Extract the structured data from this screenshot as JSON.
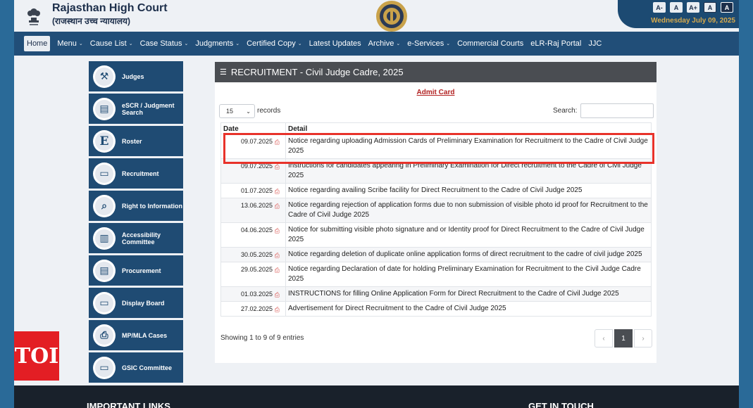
{
  "header": {
    "title": "Rajasthan High Court",
    "subtitle": "(राजस्थान उच्च न्यायालय)",
    "font_buttons": [
      "A-",
      "A",
      "A+",
      "A",
      "A"
    ],
    "date": "Wednesday July 09, 2025"
  },
  "nav": {
    "items": [
      {
        "label": "Home",
        "dropdown": false,
        "active": true
      },
      {
        "label": "Menu",
        "dropdown": true
      },
      {
        "label": "Cause List",
        "dropdown": true
      },
      {
        "label": "Case Status",
        "dropdown": true
      },
      {
        "label": "Judgments",
        "dropdown": true
      },
      {
        "label": "Certified Copy",
        "dropdown": true
      },
      {
        "label": "Latest Updates",
        "dropdown": false
      },
      {
        "label": "Archive",
        "dropdown": true
      },
      {
        "label": "e-Services",
        "dropdown": true
      },
      {
        "label": "Commercial Courts",
        "dropdown": false
      },
      {
        "label": "eLR-Raj Portal",
        "dropdown": false
      },
      {
        "label": "JJC",
        "dropdown": false
      }
    ]
  },
  "sidebar": {
    "items": [
      {
        "label": "Judges",
        "icon": "gavel-icon"
      },
      {
        "label": "eSCR / Judgment Search",
        "icon": "book-icon"
      },
      {
        "label": "Roster",
        "icon": "letter-e-icon"
      },
      {
        "label": "Recruitment",
        "icon": "id-card-icon"
      },
      {
        "label": "Right to Information",
        "icon": "magnifier-icon"
      },
      {
        "label": "Accessibility Committee",
        "icon": "document-icon"
      },
      {
        "label": "Procurement",
        "icon": "book-icon"
      },
      {
        "label": "Display Board",
        "icon": "monitor-icon"
      },
      {
        "label": "MP/MLA Cases",
        "icon": "pdf-file-icon"
      },
      {
        "label": "GSIC Committee",
        "icon": "monitor-icon"
      }
    ]
  },
  "panel": {
    "title": "RECRUITMENT - Civil Judge Cadre, 2025",
    "admit_card": "Admit Card",
    "length_value": "15",
    "length_label": "records",
    "search_label": "Search:",
    "search_value": "",
    "columns": [
      "Date",
      "Detail"
    ],
    "rows": [
      {
        "date": "09.07.2025",
        "detail": "Notice regarding uploading Admission Cards of Preliminary Examination for Recruitment to the Cadre of Civil Judge 2025"
      },
      {
        "date": "09.07.2025",
        "detail": "Instructions for candidates appearing in Preliminary Examination for Direct recruitment to the Cadre of Civil Judge 2025"
      },
      {
        "date": "01.07.2025",
        "detail": "Notice regarding availing Scribe facility for Direct Recruitment to the Cadre of Civil Judge 2025"
      },
      {
        "date": "13.06.2025",
        "detail": "Notice regarding rejection of application forms due to non submission of visible photo id proof for Recruitment to the Cadre of Civil Judge 2025"
      },
      {
        "date": "04.06.2025",
        "detail": "Notice for submitting visible photo signature and or Identity proof for Direct Recruitment to the Cadre of Civil Judge 2025"
      },
      {
        "date": "30.05.2025",
        "detail": "Notice regarding deletion of duplicate online application forms of direct recruitment to the cadre of civil judge 2025"
      },
      {
        "date": "29.05.2025",
        "detail": "Notice regarding Declaration of date for holding Preliminary Examination for Recruitment to the Civil Judge Cadre 2025"
      },
      {
        "date": "01.03.2025",
        "detail": "INSTRUCTIONS for filling Online Application Form for Direct Recruitment to the Cadre of Civil Judge 2025"
      },
      {
        "date": "27.02.2025",
        "detail": "Advertisement for Direct Recruitment to the Cadre of Civil Judge 2025"
      }
    ],
    "info": "Showing 1 to 9 of 9 entries",
    "pager": {
      "prev": "‹",
      "current": "1",
      "next": "›"
    }
  },
  "footer": {
    "left_heading": "IMPORTANT LINKS",
    "right_heading": "GET IN TOUCH"
  },
  "watermark": "TOI",
  "colors": {
    "nav_bg": "#214e78",
    "sidebar_bg": "#1f4b73",
    "panel_head_bg": "#4a4d52",
    "highlight": "#e8322a",
    "admit_link": "#b22222",
    "date_gold": "#d6a94c"
  }
}
